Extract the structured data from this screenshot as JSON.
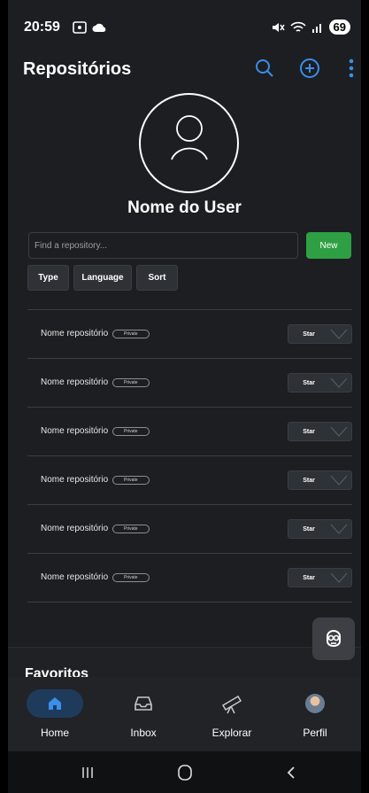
{
  "status_bar": {
    "time": "20:59",
    "battery": "69"
  },
  "app_bar": {
    "title": "Repositórios"
  },
  "profile": {
    "name": "Nome do User"
  },
  "search": {
    "placeholder": "Find a repository..."
  },
  "new_button": "New",
  "filters": [
    "Type",
    "Language",
    "Sort"
  ],
  "repositories": [
    {
      "name": "Nome repositório",
      "badge": "Private",
      "star_label": "Star"
    },
    {
      "name": "Nome repositório",
      "badge": "Private",
      "star_label": "Star"
    },
    {
      "name": "Nome repositório",
      "badge": "Private",
      "star_label": "Star"
    },
    {
      "name": "Nome repositório",
      "badge": "Private",
      "star_label": "Star"
    },
    {
      "name": "Nome repositório",
      "badge": "Private",
      "star_label": "Star"
    },
    {
      "name": "Nome repositório",
      "badge": "Private",
      "star_label": "Star"
    }
  ],
  "favorites": {
    "title": "Favoritos"
  },
  "bottom_nav": [
    {
      "label": "Home",
      "icon": "home-icon",
      "active": true
    },
    {
      "label": "Inbox",
      "icon": "inbox-icon",
      "active": false
    },
    {
      "label": "Explorar",
      "icon": "telescope-icon",
      "active": false
    },
    {
      "label": "Perfil",
      "icon": "avatar",
      "active": false
    }
  ],
  "colors": {
    "accent": "#3b8eea",
    "new_button": "#2ea043",
    "background": "#1c1e21",
    "nav_active": "#1f3b5c"
  }
}
